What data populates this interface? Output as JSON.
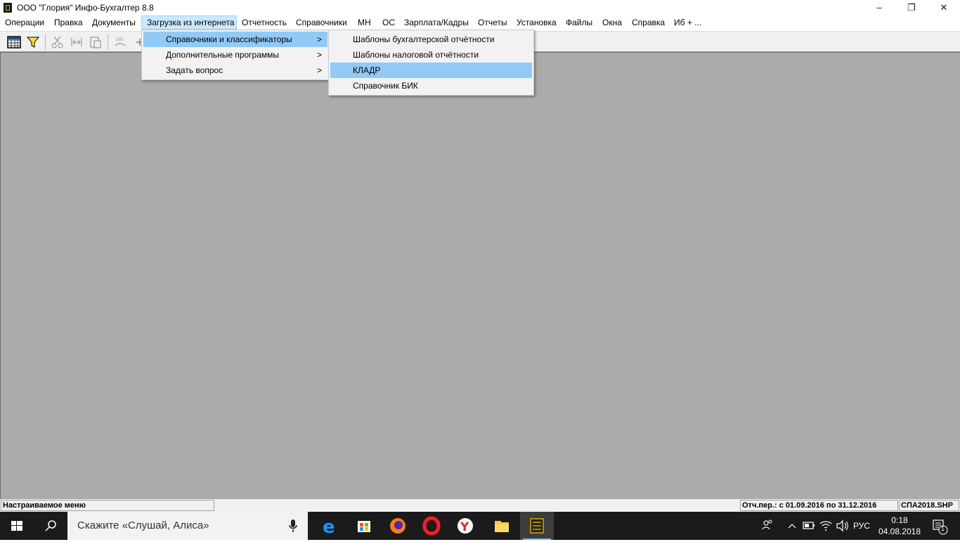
{
  "window": {
    "title": "ООО \"Глория\" Инфо-Бухгалтер 8.8",
    "minimize": "–",
    "maximize": "❐",
    "close": "✕"
  },
  "menubar": {
    "items": [
      "Операции",
      "Правка",
      "Документы",
      "Загрузка из интернета",
      "Отчетность",
      "Справочники",
      "МН",
      "ОС",
      "Зарплата/Кадры",
      "Отчеты",
      "Установка",
      "Файлы",
      "Окна",
      "Справка",
      "Иб + ..."
    ],
    "active_index": 3
  },
  "menu_level1": {
    "items": [
      {
        "label": "Справочники и классификаторы",
        "has_submenu": true
      },
      {
        "label": "Дополнительные программы",
        "has_submenu": true
      },
      {
        "label": "Задать вопрос",
        "has_submenu": true
      }
    ],
    "highlighted_index": 0,
    "arrow": ">"
  },
  "menu_level2": {
    "items": [
      {
        "label": "Шаблоны бухгалтерской отчётности"
      },
      {
        "label": "Шаблоны налоговой отчётности"
      },
      {
        "label": "КЛАДР"
      },
      {
        "label": "Справочник БИК"
      }
    ],
    "highlighted_index": 2
  },
  "statusbar": {
    "left": "Настраиваемое меню",
    "period": "Отч.пер.: с 01.09.2016 по 31.12.2016",
    "file": "СПА2018.SHP"
  },
  "taskbar": {
    "search_placeholder": "Скажите «Слушай, Алиса»",
    "apps": [
      "edge-icon",
      "store-icon",
      "firefox-icon",
      "opera-icon",
      "yandex-browser-icon",
      "file-explorer-icon",
      "info-accountant-icon"
    ],
    "language": "РУС",
    "time": "0:18",
    "date": "04.08.2018",
    "notification_count": "1"
  },
  "colors": {
    "workspace": "#ababab",
    "menu_highlight": "#91c9f7",
    "menubar_active": "#cce8ff",
    "taskbar": "#1b1b1b",
    "taskbar_underline": "#77b7f5"
  }
}
